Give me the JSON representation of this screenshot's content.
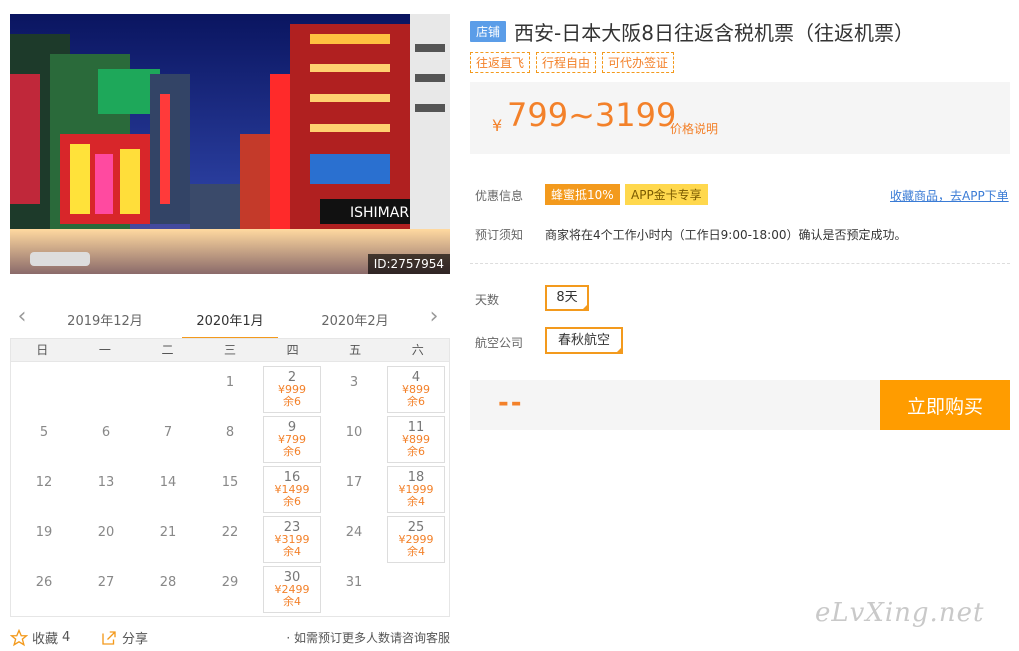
{
  "hero": {
    "id_label": "ID:2757954"
  },
  "calendar": {
    "prev_month": "2019年12月",
    "current_month": "2020年1月",
    "next_month": "2020年2月",
    "weekdays": [
      "日",
      "一",
      "二",
      "三",
      "四",
      "五",
      "六"
    ],
    "rows": [
      [
        {
          "d": ""
        },
        {
          "d": ""
        },
        {
          "d": ""
        },
        {
          "d": "1"
        },
        {
          "d": "2",
          "p": "¥999",
          "r": "余6"
        },
        {
          "d": "3"
        },
        {
          "d": "4",
          "p": "¥899",
          "r": "余6"
        }
      ],
      [
        {
          "d": "5"
        },
        {
          "d": "6"
        },
        {
          "d": "7"
        },
        {
          "d": "8"
        },
        {
          "d": "9",
          "p": "¥799",
          "r": "余6"
        },
        {
          "d": "10"
        },
        {
          "d": "11",
          "p": "¥899",
          "r": "余6"
        }
      ],
      [
        {
          "d": "12"
        },
        {
          "d": "13"
        },
        {
          "d": "14"
        },
        {
          "d": "15"
        },
        {
          "d": "16",
          "p": "¥1499",
          "r": "余6"
        },
        {
          "d": "17"
        },
        {
          "d": "18",
          "p": "¥1999",
          "r": "余4"
        }
      ],
      [
        {
          "d": "19"
        },
        {
          "d": "20"
        },
        {
          "d": "21"
        },
        {
          "d": "22"
        },
        {
          "d": "23",
          "p": "¥3199",
          "r": "余4"
        },
        {
          "d": "24"
        },
        {
          "d": "25",
          "p": "¥2999",
          "r": "余4"
        }
      ],
      [
        {
          "d": "26"
        },
        {
          "d": "27"
        },
        {
          "d": "28"
        },
        {
          "d": "29"
        },
        {
          "d": "30",
          "p": "¥2499",
          "r": "余4"
        },
        {
          "d": "31"
        },
        {
          "d": ""
        }
      ]
    ]
  },
  "bottom": {
    "favorite_label": "收藏",
    "favorite_count": "4",
    "share_label": "分享",
    "note": "· 如需预订更多人数请咨询客服"
  },
  "product": {
    "shop_badge": "店铺",
    "title": "西安-日本大阪8日往返含税机票（往返机票）",
    "tags": [
      "往返直飞",
      "行程自由",
      "可代办签证"
    ],
    "currency": "¥",
    "price_range": "799~3199",
    "price_note": "价格说明",
    "promo_label": "优惠信息",
    "promo_1": "蜂蜜抵10%",
    "promo_2": "APP金卡专享",
    "fav_app_link": "收藏商品，去APP下单",
    "notice_label": "预订须知",
    "notice_text": "商家将在4个工作小时内（工作日9:00-18:00）确认是否预定成功。",
    "days_label": "天数",
    "days_value": "8天",
    "airline_label": "航空公司",
    "airline_value": "春秋航空",
    "total": "--",
    "buy_button": "立即购买"
  },
  "watermark": "eLvXing.net"
}
